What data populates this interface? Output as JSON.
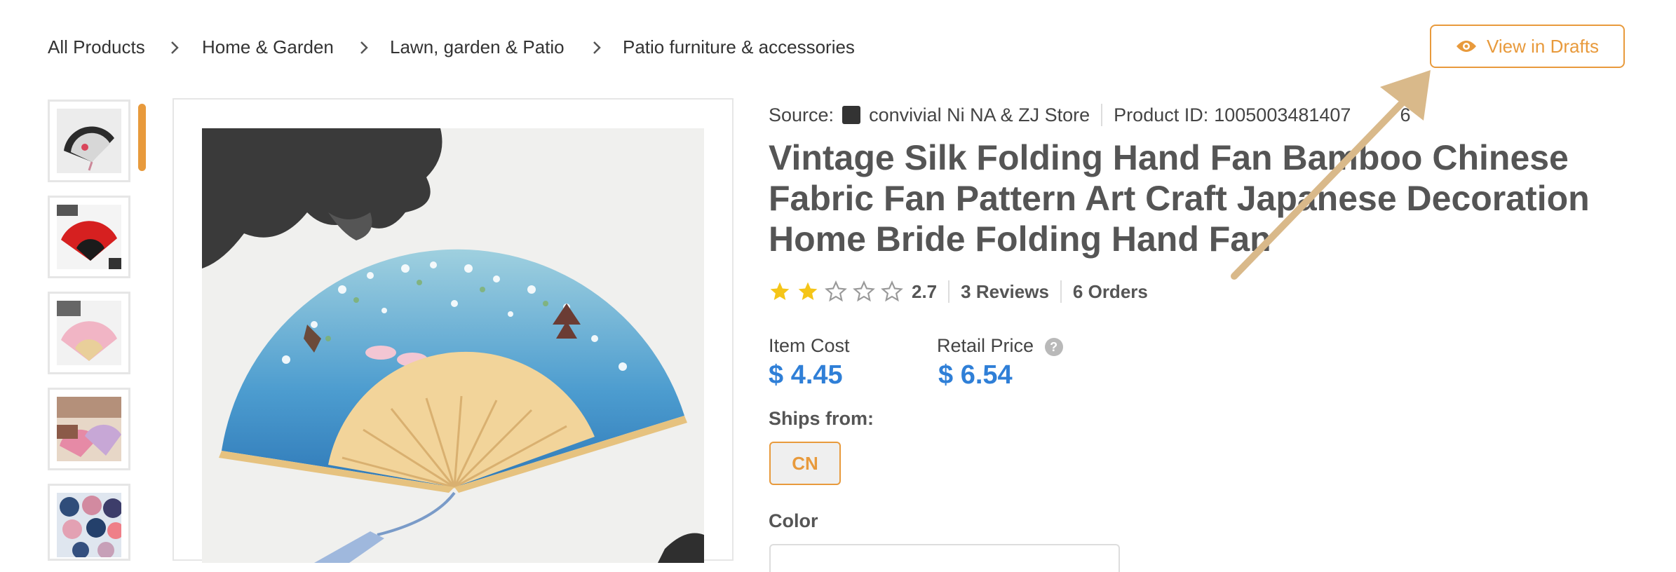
{
  "breadcrumb": {
    "items": [
      "All Products",
      "Home & Garden",
      "Lawn, garden & Patio",
      "Patio furniture & accessories"
    ],
    "separator_icon": "chevron-right-icon"
  },
  "actions": {
    "view_drafts_label": "View in Drafts",
    "view_drafts_icon": "eye-icon"
  },
  "gallery": {
    "thumbnail_count": 5,
    "selected_index": 0
  },
  "product": {
    "source_label": "Source:",
    "store_name": "convivial Ni NA & ZJ Store",
    "product_id_label": "Product ID:",
    "product_id": "1005003481407",
    "product_id_suffix": "6",
    "title": "Vintage Silk Folding Hand Fan Bamboo Chinese Fabric Fan Pattern Art Craft Japanese Decoration Home Bride Folding Hand Fan",
    "rating": 2.7,
    "rating_text": "2.7",
    "stars_filled": 2,
    "stars_total": 5,
    "reviews": "3 Reviews",
    "orders": "6 Orders"
  },
  "pricing": {
    "item_cost_label": "Item Cost",
    "item_cost": "$ 4.45",
    "retail_price_label": "Retail Price",
    "retail_price": "$ 6.54",
    "help_icon": "?"
  },
  "shipping": {
    "label": "Ships from:",
    "selected": "CN"
  },
  "options": {
    "color_label": "Color"
  },
  "colors": {
    "accent": "#e89a3c",
    "price": "#2f7fd7",
    "star": "#f5c518",
    "arrow": "#d9b98a"
  }
}
